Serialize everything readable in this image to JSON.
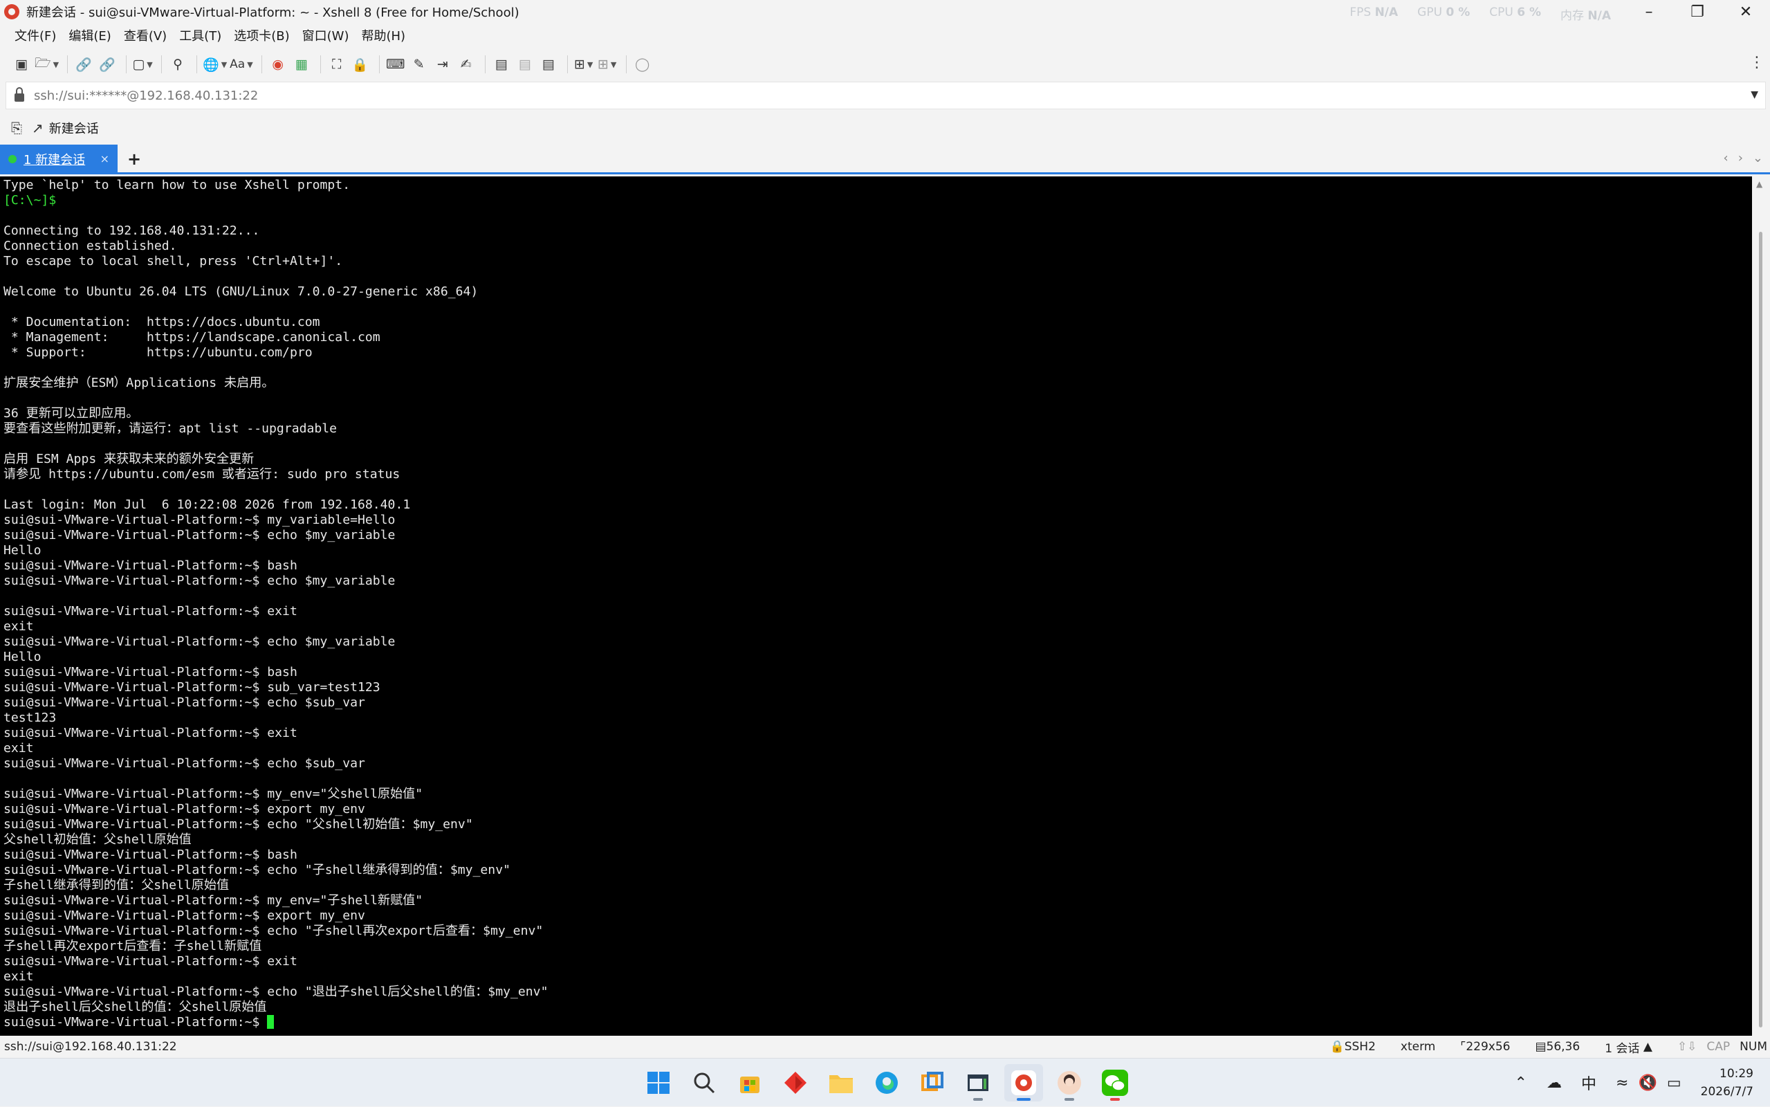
{
  "window": {
    "title": "新建会话 - sui@sui-VMware-Virtual-Platform: ~ - Xshell 8 (Free for Home/School)",
    "perf_fps_label": "FPS",
    "perf_fps_value": "N/A",
    "perf_gpu_label": "GPU",
    "perf_gpu_value": "0 %",
    "perf_cpu_label": "CPU",
    "perf_cpu_value": "6 %",
    "perf_mem_label": "内存",
    "perf_mem_value": "N/A"
  },
  "menu": {
    "items": [
      "文件(F)",
      "编辑(E)",
      "查看(V)",
      "工具(T)",
      "选项卡(B)",
      "窗口(W)",
      "帮助(H)"
    ]
  },
  "address": {
    "value": "ssh://sui:******@192.168.40.131:22"
  },
  "session_bar": {
    "new_session_label": "新建会话"
  },
  "tabs": {
    "active_label": "1 新建会话",
    "close": "×",
    "add": "+"
  },
  "terminal": {
    "lines": [
      {
        "text": "Type `help' to learn how to use Xshell prompt.",
        "color": "#e8e8e8"
      },
      {
        "text": "[C:\\~]$ ",
        "color": "#37e63a"
      },
      {
        "text": "",
        "color": "#e8e8e8"
      },
      {
        "text": "Connecting to 192.168.40.131:22...",
        "color": "#e8e8e8"
      },
      {
        "text": "Connection established.",
        "color": "#e8e8e8"
      },
      {
        "text": "To escape to local shell, press 'Ctrl+Alt+]'.",
        "color": "#e8e8e8"
      },
      {
        "text": "",
        "color": "#e8e8e8"
      },
      {
        "text": "Welcome to Ubuntu 26.04 LTS (GNU/Linux 7.0.0-27-generic x86_64)",
        "color": "#e8e8e8"
      },
      {
        "text": "",
        "color": "#e8e8e8"
      },
      {
        "text": " * Documentation:  https://docs.ubuntu.com",
        "color": "#e8e8e8"
      },
      {
        "text": " * Management:     https://landscape.canonical.com",
        "color": "#e8e8e8"
      },
      {
        "text": " * Support:        https://ubuntu.com/pro",
        "color": "#e8e8e8"
      },
      {
        "text": "",
        "color": "#e8e8e8"
      },
      {
        "text": "扩展安全维护（ESM）Applications 未启用。",
        "color": "#e8e8e8"
      },
      {
        "text": "",
        "color": "#e8e8e8"
      },
      {
        "text": "36 更新可以立即应用。",
        "color": "#e8e8e8"
      },
      {
        "text": "要查看这些附加更新，请运行：apt list --upgradable",
        "color": "#e8e8e8"
      },
      {
        "text": "",
        "color": "#e8e8e8"
      },
      {
        "text": "启用 ESM Apps 来获取未来的额外安全更新",
        "color": "#e8e8e8"
      },
      {
        "text": "请参见 https://ubuntu.com/esm 或者运行: sudo pro status",
        "color": "#e8e8e8"
      },
      {
        "text": "",
        "color": "#e8e8e8"
      },
      {
        "text": "Last login: Mon Jul  6 10:22:08 2026 from 192.168.40.1",
        "color": "#e8e8e8"
      },
      {
        "text": "sui@sui-VMware-Virtual-Platform:~$ my_variable=Hello",
        "color": "#e8e8e8"
      },
      {
        "text": "sui@sui-VMware-Virtual-Platform:~$ echo $my_variable",
        "color": "#e8e8e8"
      },
      {
        "text": "Hello",
        "color": "#e8e8e8"
      },
      {
        "text": "sui@sui-VMware-Virtual-Platform:~$ bash",
        "color": "#e8e8e8"
      },
      {
        "text": "sui@sui-VMware-Virtual-Platform:~$ echo $my_variable",
        "color": "#e8e8e8"
      },
      {
        "text": "",
        "color": "#e8e8e8"
      },
      {
        "text": "sui@sui-VMware-Virtual-Platform:~$ exit",
        "color": "#e8e8e8"
      },
      {
        "text": "exit",
        "color": "#e8e8e8"
      },
      {
        "text": "sui@sui-VMware-Virtual-Platform:~$ echo $my_variable",
        "color": "#e8e8e8"
      },
      {
        "text": "Hello",
        "color": "#e8e8e8"
      },
      {
        "text": "sui@sui-VMware-Virtual-Platform:~$ bash",
        "color": "#e8e8e8"
      },
      {
        "text": "sui@sui-VMware-Virtual-Platform:~$ sub_var=test123",
        "color": "#e8e8e8"
      },
      {
        "text": "sui@sui-VMware-Virtual-Platform:~$ echo $sub_var",
        "color": "#e8e8e8"
      },
      {
        "text": "test123",
        "color": "#e8e8e8"
      },
      {
        "text": "sui@sui-VMware-Virtual-Platform:~$ exit",
        "color": "#e8e8e8"
      },
      {
        "text": "exit",
        "color": "#e8e8e8"
      },
      {
        "text": "sui@sui-VMware-Virtual-Platform:~$ echo $sub_var",
        "color": "#e8e8e8"
      },
      {
        "text": "",
        "color": "#e8e8e8"
      },
      {
        "text": "sui@sui-VMware-Virtual-Platform:~$ my_env=\"父shell原始值\"",
        "color": "#e8e8e8"
      },
      {
        "text": "sui@sui-VMware-Virtual-Platform:~$ export my_env",
        "color": "#e8e8e8"
      },
      {
        "text": "sui@sui-VMware-Virtual-Platform:~$ echo \"父shell初始值：$my_env\"",
        "color": "#e8e8e8"
      },
      {
        "text": "父shell初始值：父shell原始值",
        "color": "#e8e8e8"
      },
      {
        "text": "sui@sui-VMware-Virtual-Platform:~$ bash",
        "color": "#e8e8e8"
      },
      {
        "text": "sui@sui-VMware-Virtual-Platform:~$ echo \"子shell继承得到的值：$my_env\"",
        "color": "#e8e8e8"
      },
      {
        "text": "子shell继承得到的值：父shell原始值",
        "color": "#e8e8e8"
      },
      {
        "text": "sui@sui-VMware-Virtual-Platform:~$ my_env=\"子shell新赋值\"",
        "color": "#e8e8e8"
      },
      {
        "text": "sui@sui-VMware-Virtual-Platform:~$ export my_env",
        "color": "#e8e8e8"
      },
      {
        "text": "sui@sui-VMware-Virtual-Platform:~$ echo \"子shell再次export后查看：$my_env\"",
        "color": "#e8e8e8"
      },
      {
        "text": "子shell再次export后查看：子shell新赋值",
        "color": "#e8e8e8"
      },
      {
        "text": "sui@sui-VMware-Virtual-Platform:~$ exit",
        "color": "#e8e8e8"
      },
      {
        "text": "exit",
        "color": "#e8e8e8"
      },
      {
        "text": "sui@sui-VMware-Virtual-Platform:~$ echo \"退出子shell后父shell的值：$my_env\"",
        "color": "#e8e8e8"
      },
      {
        "text": "退出子shell后父shell的值：父shell原始值",
        "color": "#e8e8e8"
      },
      {
        "text": "sui@sui-VMware-Virtual-Platform:~$ ",
        "color": "#e8e8e8",
        "cursor": true
      }
    ],
    "cursor_color": "#22ee33"
  },
  "status": {
    "left": "ssh://sui@192.168.40.131:22",
    "protocol": "SSH2",
    "term": "xterm",
    "size": "229x56",
    "position": "56,36",
    "sessions": "1 会话",
    "cap": "CAP",
    "num": "NUM"
  },
  "taskbar": {
    "apps": [
      {
        "name": "start-icon"
      },
      {
        "name": "search-icon"
      },
      {
        "name": "store-icon"
      },
      {
        "name": "app-red-diamond-icon"
      },
      {
        "name": "file-explorer-icon"
      },
      {
        "name": "edge-icon"
      },
      {
        "name": "vmware-icon"
      },
      {
        "name": "app-window-icon"
      },
      {
        "name": "xshell-icon"
      },
      {
        "name": "avatar-app-icon"
      },
      {
        "name": "wechat-icon"
      }
    ],
    "ime": "中",
    "time": "10:29",
    "date": "2026/7/7"
  },
  "colors": {
    "accent": "#2a7de1",
    "terminal_bg": "#000000",
    "terminal_fg": "#e8e8e8",
    "prompt_green": "#37e63a"
  }
}
